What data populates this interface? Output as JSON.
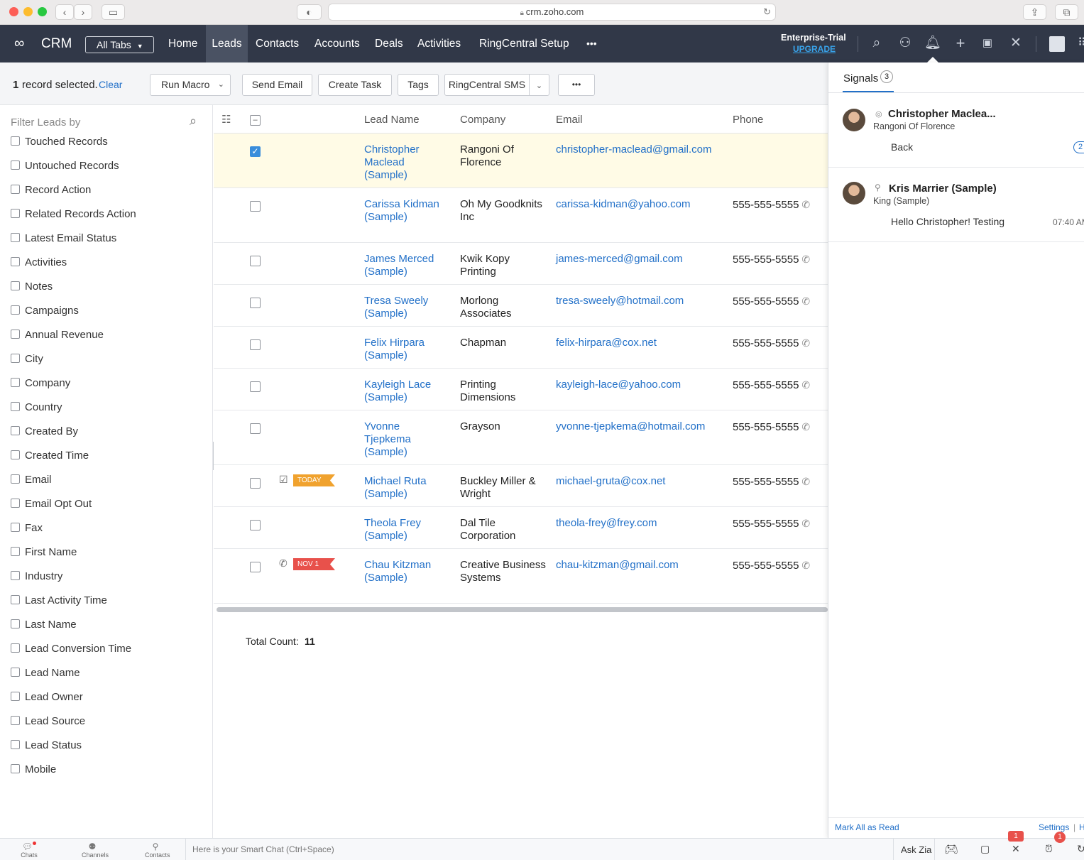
{
  "browser": {
    "url": "crm.zoho.com"
  },
  "nav": {
    "brand": "CRM",
    "all_tabs": "All Tabs",
    "tabs": [
      "Home",
      "Leads",
      "Contacts",
      "Accounts",
      "Deals",
      "Activities",
      "RingCentral Setup"
    ],
    "active_tab": "Leads",
    "more": "•••",
    "trial": "Enterprise-Trial",
    "upgrade": "UPGRADE"
  },
  "toolbar": {
    "selected_count": "1",
    "selected_text": "record selected.",
    "clear": "Clear",
    "run_macro": "Run Macro",
    "send_email": "Send Email",
    "create_task": "Create Task",
    "tags": "Tags",
    "ringcentral_sms": "RingCentral SMS",
    "more": "•••"
  },
  "sidebar": {
    "title": "Filter Leads by",
    "filters": [
      "Touched Records",
      "Untouched Records",
      "Record Action",
      "Related Records Action",
      "Latest Email Status",
      "Activities",
      "Notes",
      "Campaigns",
      "Annual Revenue",
      "City",
      "Company",
      "Country",
      "Created By",
      "Created Time",
      "Email",
      "Email Opt Out",
      "Fax",
      "First Name",
      "Industry",
      "Last Activity Time",
      "Last Name",
      "Lead Conversion Time",
      "Lead Name",
      "Lead Owner",
      "Lead Source",
      "Lead Status",
      "Mobile"
    ]
  },
  "table": {
    "columns": [
      "Lead Name",
      "Company",
      "Email",
      "Phone"
    ],
    "rows": [
      {
        "name": "Christopher Maclead (Sample)",
        "company": "Rangoni Of Florence",
        "email": "christopher-maclead@gmail.com",
        "phone": "",
        "selected": true,
        "flag": ""
      },
      {
        "name": "Carissa Kidman (Sample)",
        "company": "Oh My Goodknits Inc",
        "email": "carissa-kidman@yahoo.com",
        "phone": "555-555-5555",
        "selected": false,
        "flag": ""
      },
      {
        "name": "James Merced (Sample)",
        "company": "Kwik Kopy Printing",
        "email": "james-merced@gmail.com",
        "phone": "555-555-5555",
        "selected": false,
        "flag": ""
      },
      {
        "name": "Tresa Sweely (Sample)",
        "company": "Morlong Associates",
        "email": "tresa-sweely@hotmail.com",
        "phone": "555-555-5555",
        "selected": false,
        "flag": ""
      },
      {
        "name": "Felix Hirpara (Sample)",
        "company": "Chapman",
        "email": "felix-hirpara@cox.net",
        "phone": "555-555-5555",
        "selected": false,
        "flag": ""
      },
      {
        "name": "Kayleigh Lace (Sample)",
        "company": "Printing Dimensions",
        "email": "kayleigh-lace@yahoo.com",
        "phone": "555-555-5555",
        "selected": false,
        "flag": ""
      },
      {
        "name": "Yvonne Tjepkema (Sample)",
        "company": "Grayson",
        "email": "yvonne-tjepkema@hotmail.com",
        "phone": "555-555-5555",
        "selected": false,
        "flag": ""
      },
      {
        "name": "Michael Ruta (Sample)",
        "company": "Buckley Miller & Wright",
        "email": "michael-gruta@cox.net",
        "phone": "555-555-5555",
        "selected": false,
        "flag": "TODAY",
        "flag_color": "#f0a22e",
        "activity_icon": "task-icon"
      },
      {
        "name": "Theola Frey (Sample)",
        "company": "Dal Tile Corporation",
        "email": "theola-frey@frey.com",
        "phone": "555-555-5555",
        "selected": false,
        "flag": ""
      },
      {
        "name": "Chau Kitzman (Sample)",
        "company": "Creative Business Systems",
        "email": "chau-kitzman@gmail.com",
        "phone": "555-555-5555",
        "selected": false,
        "flag": "NOV 1",
        "flag_color": "#e8514b",
        "activity_icon": "call-icon"
      }
    ],
    "total_label": "Total Count:",
    "total_value": "11"
  },
  "signals": {
    "title": "Signals",
    "count": "3",
    "items": [
      {
        "name": "Christopher Maclea...",
        "company": "Rangoni Of Florence",
        "message": "Back",
        "badge": "2",
        "time": ""
      },
      {
        "name": "Kris Marrier (Sample)",
        "company": "King (Sample)",
        "message": "Hello Christopher! Testing",
        "badge": "",
        "time": "07:40 AM"
      }
    ],
    "mark_all": "Mark All as Read",
    "settings": "Settings",
    "help": "H"
  },
  "bottom": {
    "chats": "Chats",
    "channels": "Channels",
    "contacts": "Contacts",
    "smart_chat_placeholder": "Here is your Smart Chat (Ctrl+Space)",
    "ask_zia": "Ask Zia",
    "badge1": "1",
    "badge2": "1"
  },
  "colors": {
    "nav_bg": "#313848",
    "link": "#2270c8",
    "accent": "#3a8ddb"
  }
}
